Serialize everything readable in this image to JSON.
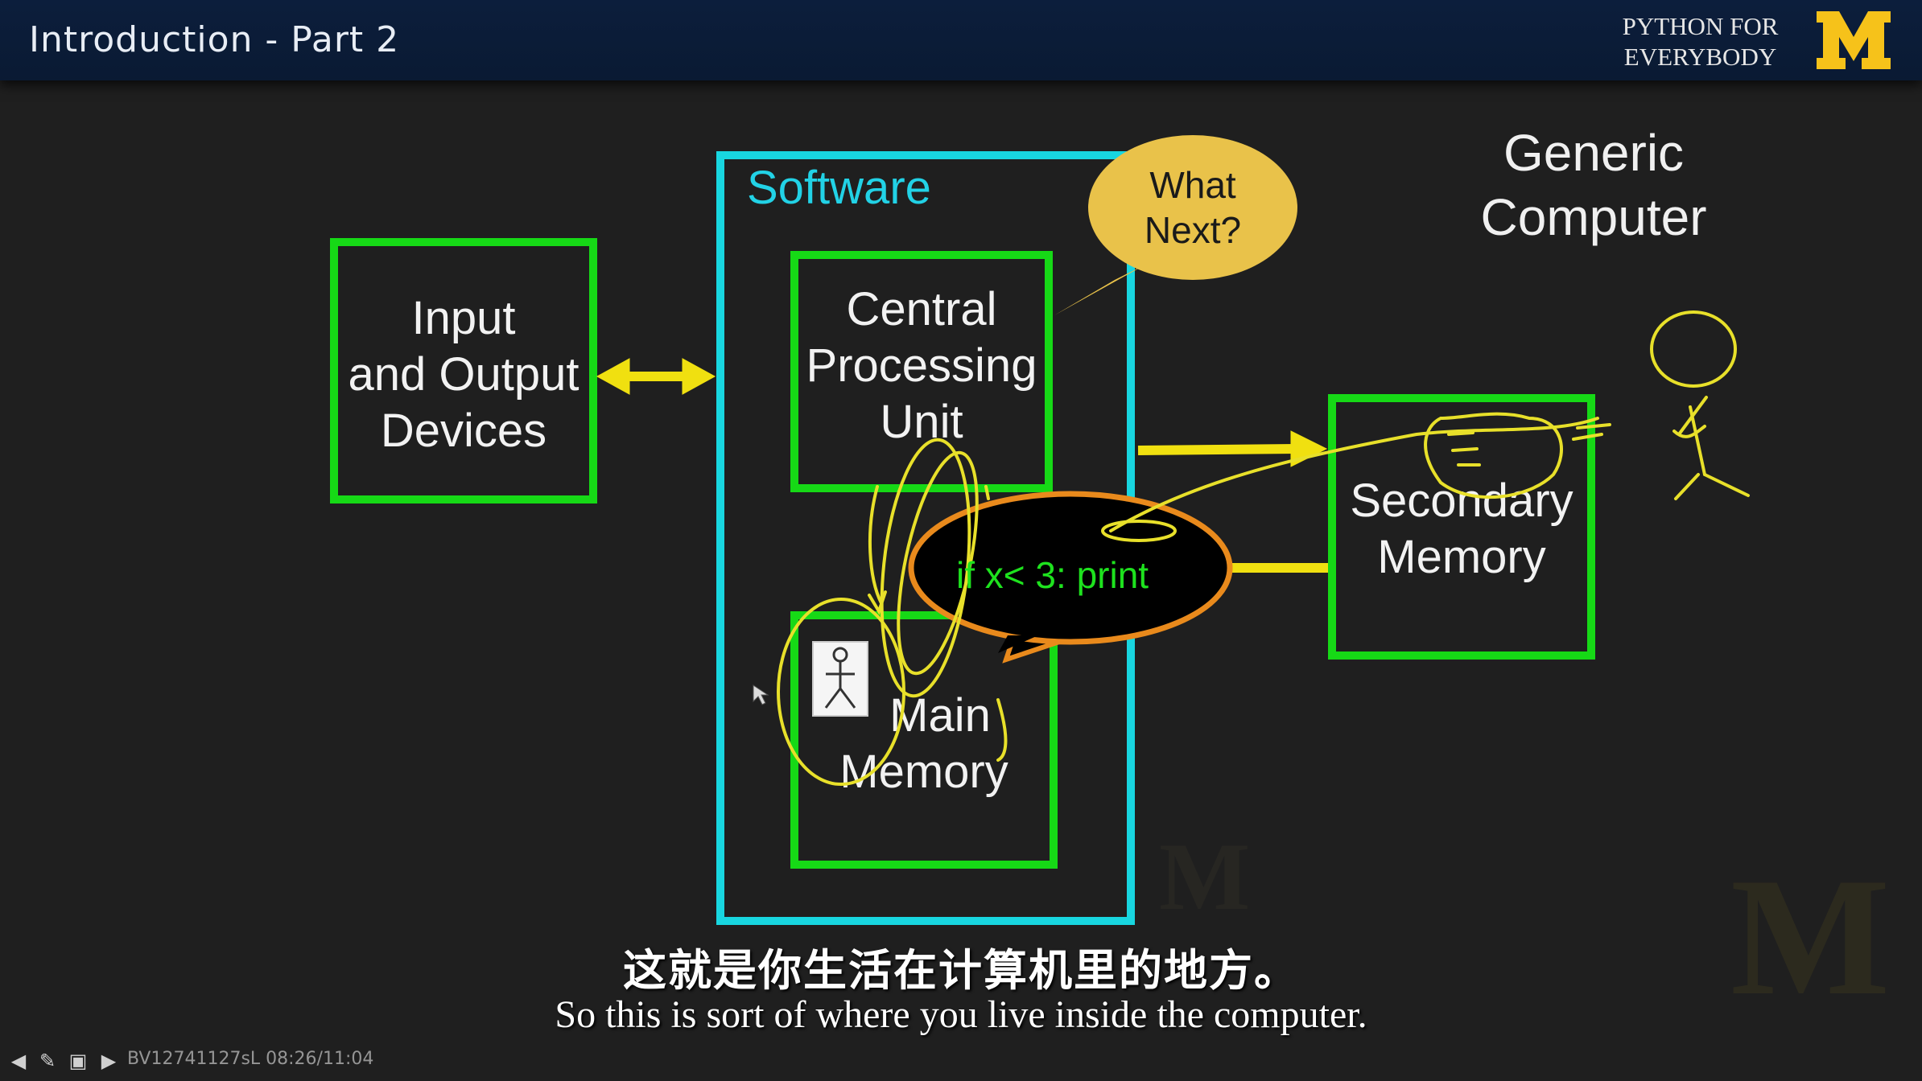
{
  "header": {
    "title": "Introduction - Part 2",
    "brand_line1": "PYTHON FOR",
    "brand_line2": "EVERYBODY",
    "logo": "M"
  },
  "diagram": {
    "title_line1": "Generic",
    "title_line2": "Computer",
    "software_label": "Software",
    "io_box": [
      "Input",
      "and Output",
      "Devices"
    ],
    "cpu_box": [
      "Central",
      "Processing",
      "Unit"
    ],
    "main_memory_box": [
      "Main",
      "Memory"
    ],
    "secondary_memory_box": [
      "Secondary",
      "Memory"
    ],
    "speech_bubble": [
      "What",
      "Next?"
    ],
    "code_bubble": "if x< 3: print"
  },
  "subtitles": {
    "chinese": "这就是你生活在计算机里的地方。",
    "english": "So this is sort of where you live inside the computer."
  },
  "player": {
    "info": "BV12741127sL 08:26/11:04"
  },
  "colors": {
    "box_green": "#16d916",
    "software_cyan": "#18d6e0",
    "arrow_yellow": "#f0e010",
    "bubble_gold": "#e9c24a",
    "code_orange": "#e98a1c",
    "header_navy": "#0c1e3c",
    "michigan_maize": "#f6c21a"
  },
  "icons": [
    "back-icon",
    "pen-icon",
    "slides-icon",
    "forward-icon",
    "stick-figure-icon"
  ]
}
